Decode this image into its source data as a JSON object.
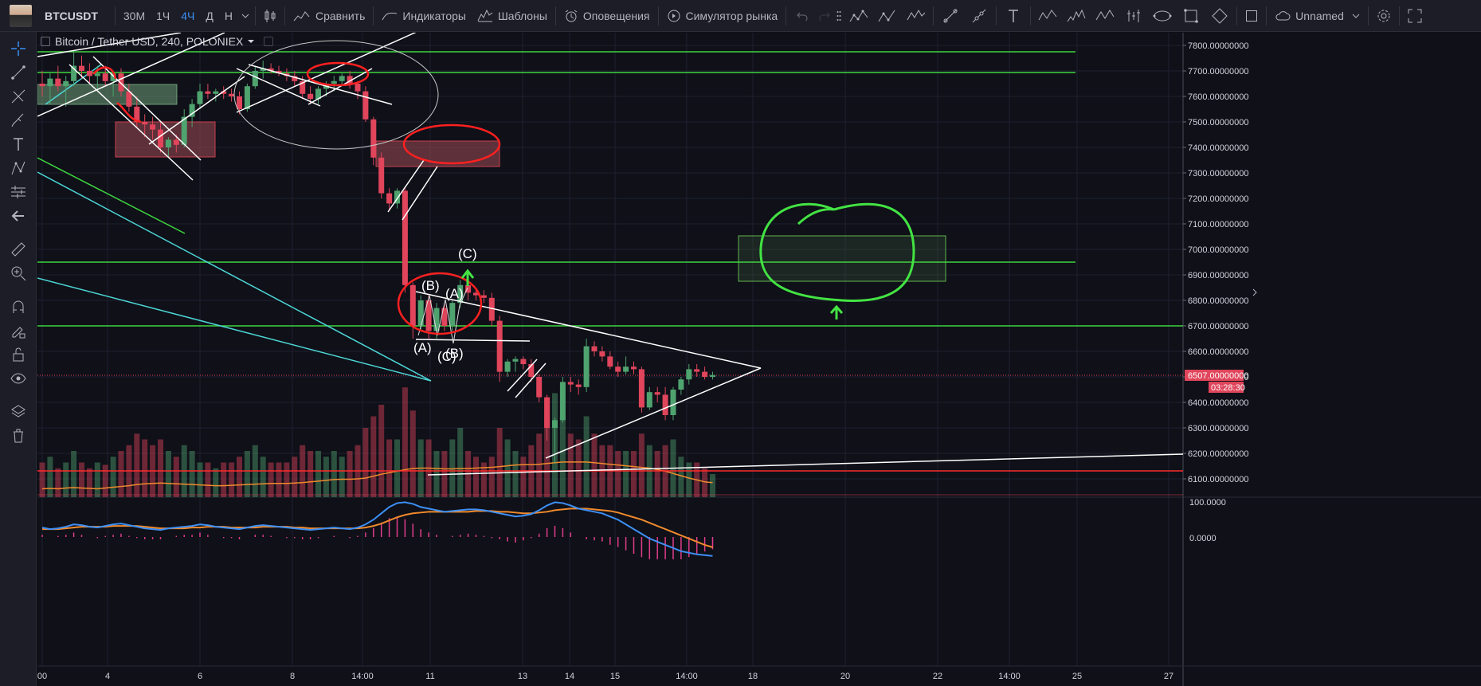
{
  "toolbar": {
    "symbol": "BTCUSDT",
    "intervals": [
      "30M",
      "1Ч",
      "4Ч",
      "Д",
      "Н"
    ],
    "active_interval": "4Ч",
    "compare": "Сравнить",
    "indicators": "Индикаторы",
    "templates": "Шаблоны",
    "alerts": "Оповещения",
    "replay": "Симулятор рынка",
    "layout_name": "Unnamed"
  },
  "legend": {
    "title": "Bitcoin / Tether USD, 240, POLONIEX"
  },
  "price_axis": {
    "labels": [
      "7800.00000000",
      "7700.00000000",
      "7600.00000000",
      "7500.00000000",
      "7400.00000000",
      "7300.00000000",
      "7200.00000000",
      "7100.00000000",
      "7000.00000000",
      "6900.00000000",
      "6800.00000000",
      "6700.00000000",
      "6600.00000000",
      "6500.00000000",
      "6400.00000000",
      "6300.00000000",
      "6200.00000000",
      "6100.00000000"
    ],
    "current_price": "6507.00000000",
    "countdown": "03:28:30"
  },
  "indicator_axis": {
    "labels": [
      "100.0000",
      "0.0000"
    ]
  },
  "time_axis": {
    "labels": [
      "00",
      "4",
      "6",
      "8",
      "14:00",
      "11",
      "13",
      "14",
      "15",
      "14:00",
      "18",
      "20",
      "22",
      "14:00",
      "25",
      "27"
    ]
  },
  "annotations": {
    "wave_labels": [
      "(C)",
      "(B)",
      "(A)",
      "(A)",
      "(C)",
      "(B)"
    ]
  },
  "colors": {
    "background": "#0f1018",
    "bull": "#4fa36f",
    "bear": "#e0455b",
    "support_line": "#3ed63e",
    "red_line": "#ff2a2a",
    "cyan_line": "#4dd6d6",
    "accent": "#3d8ff5"
  },
  "chart_data": {
    "type": "candlestick",
    "symbol": "BTCUSDT",
    "candles": [
      {
        "o": 7650,
        "h": 7700,
        "l": 7600,
        "c": 7640
      },
      {
        "o": 7640,
        "h": 7690,
        "l": 7570,
        "c": 7670
      },
      {
        "o": 7670,
        "h": 7720,
        "l": 7620,
        "c": 7640
      },
      {
        "o": 7640,
        "h": 7680,
        "l": 7560,
        "c": 7660
      },
      {
        "o": 7660,
        "h": 7780,
        "l": 7640,
        "c": 7720
      },
      {
        "o": 7720,
        "h": 7760,
        "l": 7670,
        "c": 7700
      },
      {
        "o": 7700,
        "h": 7730,
        "l": 7650,
        "c": 7680
      },
      {
        "o": 7680,
        "h": 7720,
        "l": 7630,
        "c": 7690
      },
      {
        "o": 7690,
        "h": 7720,
        "l": 7640,
        "c": 7660
      },
      {
        "o": 7660,
        "h": 7700,
        "l": 7600,
        "c": 7690
      },
      {
        "o": 7690,
        "h": 7710,
        "l": 7600,
        "c": 7620
      },
      {
        "o": 7620,
        "h": 7650,
        "l": 7540,
        "c": 7560
      },
      {
        "o": 7560,
        "h": 7600,
        "l": 7480,
        "c": 7500
      },
      {
        "o": 7500,
        "h": 7530,
        "l": 7440,
        "c": 7490
      },
      {
        "o": 7490,
        "h": 7520,
        "l": 7430,
        "c": 7470
      },
      {
        "o": 7470,
        "h": 7500,
        "l": 7380,
        "c": 7400
      },
      {
        "o": 7400,
        "h": 7440,
        "l": 7360,
        "c": 7430
      },
      {
        "o": 7430,
        "h": 7450,
        "l": 7380,
        "c": 7410
      },
      {
        "o": 7410,
        "h": 7550,
        "l": 7400,
        "c": 7520
      },
      {
        "o": 7520,
        "h": 7590,
        "l": 7480,
        "c": 7570
      },
      {
        "o": 7570,
        "h": 7650,
        "l": 7550,
        "c": 7620
      },
      {
        "o": 7620,
        "h": 7650,
        "l": 7590,
        "c": 7610
      },
      {
        "o": 7610,
        "h": 7630,
        "l": 7580,
        "c": 7620
      },
      {
        "o": 7620,
        "h": 7640,
        "l": 7590,
        "c": 7610
      },
      {
        "o": 7610,
        "h": 7630,
        "l": 7580,
        "c": 7600
      },
      {
        "o": 7600,
        "h": 7620,
        "l": 7530,
        "c": 7550
      },
      {
        "o": 7550,
        "h": 7650,
        "l": 7540,
        "c": 7640
      },
      {
        "o": 7640,
        "h": 7720,
        "l": 7630,
        "c": 7700
      },
      {
        "o": 7700,
        "h": 7740,
        "l": 7670,
        "c": 7710
      },
      {
        "o": 7710,
        "h": 7730,
        "l": 7690,
        "c": 7700
      },
      {
        "o": 7700,
        "h": 7720,
        "l": 7680,
        "c": 7690
      },
      {
        "o": 7690,
        "h": 7710,
        "l": 7660,
        "c": 7680
      },
      {
        "o": 7680,
        "h": 7700,
        "l": 7640,
        "c": 7660
      },
      {
        "o": 7660,
        "h": 7680,
        "l": 7590,
        "c": 7610
      },
      {
        "o": 7610,
        "h": 7640,
        "l": 7570,
        "c": 7590
      },
      {
        "o": 7590,
        "h": 7640,
        "l": 7570,
        "c": 7630
      },
      {
        "o": 7630,
        "h": 7660,
        "l": 7600,
        "c": 7650
      },
      {
        "o": 7650,
        "h": 7680,
        "l": 7620,
        "c": 7660
      },
      {
        "o": 7660,
        "h": 7690,
        "l": 7640,
        "c": 7680
      },
      {
        "o": 7680,
        "h": 7700,
        "l": 7630,
        "c": 7650
      },
      {
        "o": 7650,
        "h": 7660,
        "l": 7590,
        "c": 7620
      },
      {
        "o": 7620,
        "h": 7640,
        "l": 7500,
        "c": 7510
      },
      {
        "o": 7510,
        "h": 7520,
        "l": 7330,
        "c": 7360
      },
      {
        "o": 7360,
        "h": 7380,
        "l": 7200,
        "c": 7220
      },
      {
        "o": 7220,
        "h": 7240,
        "l": 7150,
        "c": 7180
      },
      {
        "o": 7180,
        "h": 7240,
        "l": 7160,
        "c": 7230
      },
      {
        "o": 7230,
        "h": 7240,
        "l": 6830,
        "c": 6860
      },
      {
        "o": 6860,
        "h": 6870,
        "l": 6650,
        "c": 6700
      },
      {
        "o": 6700,
        "h": 6820,
        "l": 6680,
        "c": 6800
      },
      {
        "o": 6800,
        "h": 6820,
        "l": 6650,
        "c": 6680
      },
      {
        "o": 6680,
        "h": 6790,
        "l": 6650,
        "c": 6770
      },
      {
        "o": 6770,
        "h": 6790,
        "l": 6680,
        "c": 6700
      },
      {
        "o": 6700,
        "h": 6800,
        "l": 6680,
        "c": 6790
      },
      {
        "o": 6790,
        "h": 6880,
        "l": 6770,
        "c": 6860
      },
      {
        "o": 6860,
        "h": 6880,
        "l": 6800,
        "c": 6830
      },
      {
        "o": 6830,
        "h": 6840,
        "l": 6800,
        "c": 6820
      },
      {
        "o": 6820,
        "h": 6840,
        "l": 6790,
        "c": 6810
      },
      {
        "o": 6810,
        "h": 6830,
        "l": 6700,
        "c": 6720
      },
      {
        "o": 6720,
        "h": 6740,
        "l": 6480,
        "c": 6520
      },
      {
        "o": 6520,
        "h": 6570,
        "l": 6500,
        "c": 6560
      },
      {
        "o": 6560,
        "h": 6580,
        "l": 6520,
        "c": 6570
      },
      {
        "o": 6570,
        "h": 6580,
        "l": 6530,
        "c": 6550
      },
      {
        "o": 6550,
        "h": 6570,
        "l": 6480,
        "c": 6500
      },
      {
        "o": 6500,
        "h": 6510,
        "l": 6400,
        "c": 6420
      },
      {
        "o": 6420,
        "h": 6430,
        "l": 6250,
        "c": 6300
      },
      {
        "o": 6300,
        "h": 6340,
        "l": 6160,
        "c": 6330
      },
      {
        "o": 6330,
        "h": 6500,
        "l": 6320,
        "c": 6480
      },
      {
        "o": 6480,
        "h": 6500,
        "l": 6440,
        "c": 6470
      },
      {
        "o": 6470,
        "h": 6490,
        "l": 6430,
        "c": 6460
      },
      {
        "o": 6460,
        "h": 6650,
        "l": 6440,
        "c": 6620
      },
      {
        "o": 6620,
        "h": 6640,
        "l": 6580,
        "c": 6600
      },
      {
        "o": 6600,
        "h": 6620,
        "l": 6560,
        "c": 6580
      },
      {
        "o": 6580,
        "h": 6600,
        "l": 6530,
        "c": 6540
      },
      {
        "o": 6540,
        "h": 6560,
        "l": 6500,
        "c": 6520
      },
      {
        "o": 6520,
        "h": 6580,
        "l": 6510,
        "c": 6540
      },
      {
        "o": 6540,
        "h": 6560,
        "l": 6510,
        "c": 6530
      },
      {
        "o": 6530,
        "h": 6540,
        "l": 6360,
        "c": 6380
      },
      {
        "o": 6380,
        "h": 6460,
        "l": 6370,
        "c": 6440
      },
      {
        "o": 6440,
        "h": 6460,
        "l": 6400,
        "c": 6430
      },
      {
        "o": 6430,
        "h": 6460,
        "l": 6330,
        "c": 6350
      },
      {
        "o": 6350,
        "h": 6460,
        "l": 6330,
        "c": 6450
      },
      {
        "o": 6450,
        "h": 6500,
        "l": 6430,
        "c": 6490
      },
      {
        "o": 6490,
        "h": 6550,
        "l": 6470,
        "c": 6530
      },
      {
        "o": 6530,
        "h": 6550,
        "l": 6500,
        "c": 6520
      },
      {
        "o": 6520,
        "h": 6540,
        "l": 6490,
        "c": 6500
      },
      {
        "o": 6500,
        "h": 6520,
        "l": 6490,
        "c": 6507
      }
    ],
    "x_labels": [
      "00",
      "4",
      "6",
      "8",
      "14:00",
      "11",
      "13",
      "14",
      "15",
      "14:00",
      "18",
      "20",
      "22",
      "14:00",
      "25",
      "27"
    ],
    "ylim": [
      6050,
      7850
    ],
    "horizontal_levels_green": [
      7770,
      7690,
      6950,
      6700
    ],
    "horizontal_level_red": 6130,
    "current_price": 6507,
    "volume_ma": [
      0.22,
      0.23,
      0.22,
      0.24,
      0.25,
      0.24,
      0.23,
      0.22,
      0.24,
      0.26,
      0.28,
      0.3,
      0.33,
      0.35,
      0.36,
      0.37,
      0.36,
      0.35,
      0.34,
      0.33,
      0.32,
      0.31,
      0.3,
      0.3,
      0.31,
      0.32,
      0.33,
      0.34,
      0.35,
      0.36,
      0.36,
      0.36,
      0.37,
      0.38,
      0.4,
      0.42,
      0.44,
      0.46,
      0.47,
      0.47,
      0.48,
      0.5,
      0.55,
      0.6,
      0.64,
      0.68,
      0.72,
      0.75,
      0.76,
      0.76,
      0.75,
      0.74,
      0.74,
      0.75,
      0.75,
      0.76,
      0.77,
      0.78,
      0.8,
      0.82,
      0.84,
      0.85,
      0.85,
      0.86,
      0.88,
      0.9,
      0.92,
      0.92,
      0.92,
      0.92,
      0.9,
      0.88,
      0.86,
      0.84,
      0.82,
      0.8,
      0.78,
      0.76,
      0.72,
      0.68,
      0.62,
      0.56,
      0.5,
      0.45,
      0.4,
      0.38
    ],
    "volumes": [
      0.3,
      0.35,
      0.25,
      0.3,
      0.4,
      0.3,
      0.25,
      0.3,
      0.28,
      0.35,
      0.4,
      0.45,
      0.55,
      0.5,
      0.45,
      0.5,
      0.4,
      0.35,
      0.45,
      0.4,
      0.3,
      0.3,
      0.25,
      0.3,
      0.3,
      0.35,
      0.4,
      0.45,
      0.35,
      0.3,
      0.3,
      0.3,
      0.35,
      0.45,
      0.4,
      0.4,
      0.35,
      0.4,
      0.35,
      0.4,
      0.45,
      0.6,
      0.7,
      0.8,
      0.5,
      0.5,
      0.95,
      0.75,
      0.5,
      0.5,
      0.4,
      0.4,
      0.5,
      0.6,
      0.4,
      0.35,
      0.3,
      0.35,
      0.6,
      0.5,
      0.4,
      0.35,
      0.45,
      0.55,
      0.85,
      0.9,
      0.7,
      0.55,
      0.5,
      0.7,
      0.55,
      0.45,
      0.45,
      0.4,
      0.4,
      0.4,
      0.55,
      0.45,
      0.4,
      0.45,
      0.5,
      0.35,
      0.3,
      0.3,
      0.25,
      0.2
    ],
    "rsi_fast": [
      62,
      60,
      61,
      63,
      66,
      65,
      63,
      62,
      64,
      66,
      67,
      65,
      63,
      61,
      60,
      59,
      61,
      62,
      63,
      64,
      66,
      65,
      63,
      62,
      61,
      60,
      62,
      64,
      65,
      64,
      63,
      62,
      61,
      60,
      59,
      60,
      61,
      62,
      61,
      60,
      62,
      66,
      72,
      80,
      88,
      93,
      94,
      92,
      88,
      86,
      84,
      82,
      83,
      84,
      85,
      85,
      84,
      82,
      80,
      78,
      76,
      77,
      79,
      84,
      90,
      94,
      93,
      90,
      86,
      84,
      82,
      80,
      76,
      72,
      66,
      60,
      54,
      48,
      44,
      40,
      36,
      32,
      30,
      28,
      27,
      26
    ],
    "rsi_slow": [
      60,
      60,
      60,
      61,
      62,
      63,
      63,
      63,
      63,
      64,
      64,
      64,
      64,
      63,
      62,
      61,
      61,
      61,
      61,
      62,
      62,
      63,
      63,
      63,
      62,
      62,
      62,
      62,
      63,
      63,
      63,
      63,
      62,
      62,
      61,
      61,
      61,
      61,
      61,
      61,
      61,
      62,
      64,
      67,
      71,
      75,
      78,
      80,
      81,
      82,
      82,
      82,
      82,
      82,
      82,
      83,
      83,
      83,
      82,
      82,
      81,
      80,
      80,
      81,
      82,
      84,
      85,
      86,
      86,
      86,
      85,
      84,
      83,
      81,
      78,
      75,
      72,
      68,
      64,
      60,
      56,
      52,
      48,
      44,
      40,
      37
    ],
    "rsi_hist": [
      2,
      0,
      1,
      2,
      4,
      2,
      0,
      -1,
      1,
      2,
      3,
      1,
      -1,
      -2,
      -2,
      -2,
      0,
      1,
      2,
      2,
      4,
      2,
      0,
      -1,
      -1,
      -2,
      0,
      2,
      2,
      1,
      0,
      -1,
      -1,
      -2,
      -2,
      -1,
      0,
      1,
      0,
      -1,
      1,
      4,
      8,
      13,
      17,
      18,
      16,
      12,
      7,
      4,
      2,
      0,
      1,
      2,
      3,
      2,
      1,
      -1,
      -2,
      -4,
      -5,
      -3,
      -1,
      3,
      8,
      10,
      8,
      4,
      0,
      -2,
      -3,
      -4,
      -7,
      -9,
      -12,
      -15,
      -18,
      -20,
      -20,
      -20,
      -20,
      -20,
      -18,
      -16,
      -13,
      -11
    ]
  }
}
